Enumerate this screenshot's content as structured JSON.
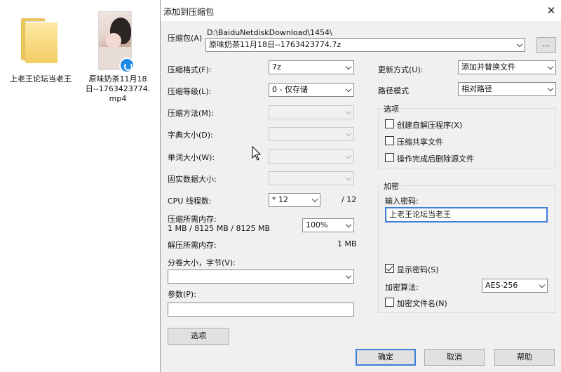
{
  "desktop": {
    "folder_label": "上老王论坛当老王",
    "video_label": "原味奶茶11月18日--1763423774.mp4"
  },
  "dialog": {
    "title": "添加到压缩包",
    "archive_label": "压缩包(A)",
    "archive_path": "D:\\BaiduNetdiskDownload\\1454\\",
    "archive_name": "原味奶茶11月18日--1763423774.7z",
    "browse_label": "...",
    "format_label": "压缩格式(F):",
    "format_value": "7z",
    "level_label": "压缩等级(L):",
    "level_value": "0 - 仅存储",
    "method_label": "压缩方法(M):",
    "dict_label": "字典大小(D):",
    "word_label": "单词大小(W):",
    "solid_label": "固实数据大小:",
    "cpu_label": "CPU 线程数:",
    "cpu_value": "* 12",
    "cpu_total": "/ 12",
    "mem_comp_label": "压缩所需内存:",
    "mem_comp_values": "1 MB / 8125 MB / 8125 MB",
    "mem_percent": "100%",
    "mem_decomp_label": "解压所需内存:",
    "mem_decomp_value": "1 MB",
    "split_label": "分卷大小，字节(V):",
    "params_label": "参数(P):",
    "options_button": "选项",
    "update_label": "更新方式(U):",
    "update_value": "添加并替换文件",
    "path_label": "路径模式",
    "path_value": "相对路径",
    "options_group": {
      "title": "选项",
      "sfx": "创建自解压程序(X)",
      "shared": "压缩共享文件",
      "delete_after": "操作完成后删除源文件"
    },
    "encrypt_group": {
      "title": "加密",
      "password_label": "输入密码:",
      "password_value": "上老王论坛当老王",
      "show_password": "显示密码(S)",
      "show_password_checked": true,
      "algo_label": "加密算法:",
      "algo_value": "AES-256",
      "encrypt_names": "加密文件名(N)"
    },
    "ok_button": "确定",
    "cancel_button": "取消",
    "help_button": "帮助"
  }
}
